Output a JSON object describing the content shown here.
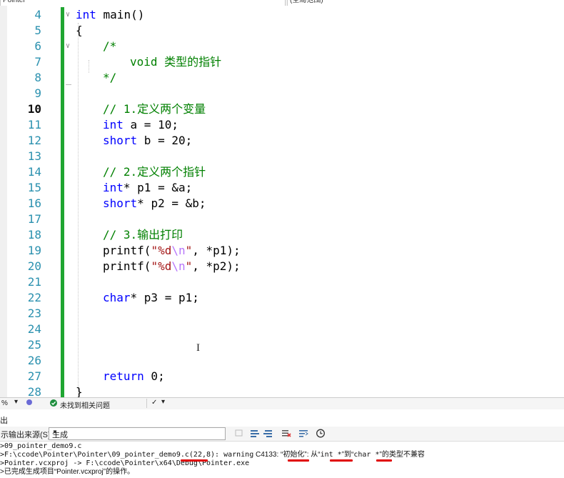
{
  "nav": {
    "project_combo": "Pointer",
    "scope_combo": "(全局范围)"
  },
  "editor": {
    "current_line": "10",
    "lines": [
      {
        "n": "4",
        "cur": false
      },
      {
        "n": "5",
        "cur": false
      },
      {
        "n": "6",
        "cur": false
      },
      {
        "n": "7",
        "cur": false
      },
      {
        "n": "8",
        "cur": false
      },
      {
        "n": "9",
        "cur": false
      },
      {
        "n": "10",
        "cur": true
      },
      {
        "n": "11",
        "cur": false
      },
      {
        "n": "12",
        "cur": false
      },
      {
        "n": "13",
        "cur": false
      },
      {
        "n": "14",
        "cur": false
      },
      {
        "n": "15",
        "cur": false
      },
      {
        "n": "16",
        "cur": false
      },
      {
        "n": "17",
        "cur": false
      },
      {
        "n": "18",
        "cur": false
      },
      {
        "n": "19",
        "cur": false
      },
      {
        "n": "20",
        "cur": false
      },
      {
        "n": "21",
        "cur": false
      },
      {
        "n": "22",
        "cur": false
      },
      {
        "n": "23",
        "cur": false
      },
      {
        "n": "24",
        "cur": false
      },
      {
        "n": "25",
        "cur": false
      },
      {
        "n": "26",
        "cur": false
      },
      {
        "n": "27",
        "cur": false
      },
      {
        "n": "28",
        "cur": false
      }
    ],
    "code": {
      "l4_kw": "int",
      "l4_rest": " main()",
      "l5": "{",
      "l6": "/*",
      "l7": "void 类型的指针",
      "l8": "*/",
      "l10": "// 1.定义两个变量",
      "l11_kw": "int",
      "l11_rest": " a = 10;",
      "l12_kw": "short",
      "l12_rest": " b = 20;",
      "l14": "// 2.定义两个指针",
      "l15_kw": "int",
      "l15_rest": "* p1 = &a;",
      "l16_kw": "short",
      "l16_rest": "* p2 = &b;",
      "l18": "// 3.输出打印",
      "l19_a": "printf(",
      "l19_s1": "\"%d",
      "l19_esc": "\\n",
      "l19_s2": "\"",
      "l19_b": ", *p1);",
      "l20_a": "printf(",
      "l20_s1": "\"%d",
      "l20_esc": "\\n",
      "l20_s2": "\"",
      "l20_b": ", *p2);",
      "l22_kw": "char",
      "l22_rest": "* p3 = p1;",
      "l27_kw": "return",
      "l27_rest": " 0;",
      "l28": "}"
    }
  },
  "status": {
    "zoom": "% ",
    "issues": "未找到相关问题"
  },
  "output": {
    "title": "出",
    "source_label": "示输出来源(S):",
    "source_value": "生成",
    "lines": [
      ">09_pointer_demo9.c",
      ">F:\\ccode\\Pointer\\Pointer\\09_pointer_demo9.c(22,8): ",
      ">Pointer.vcxproj -> F:\\ccode\\Pointer\\x64\\Debug\\Pointer.exe",
      ">已完成生成项目“Pointer.vcxproj”的操作。"
    ],
    "warn_word": "warning",
    "warn_rest": " C4133: “初始化”: 从“",
    "type1": "int *",
    "mid": "”到“",
    "type2": "char *",
    "tail1": "”的类型",
    "tail2": "不兼容"
  }
}
